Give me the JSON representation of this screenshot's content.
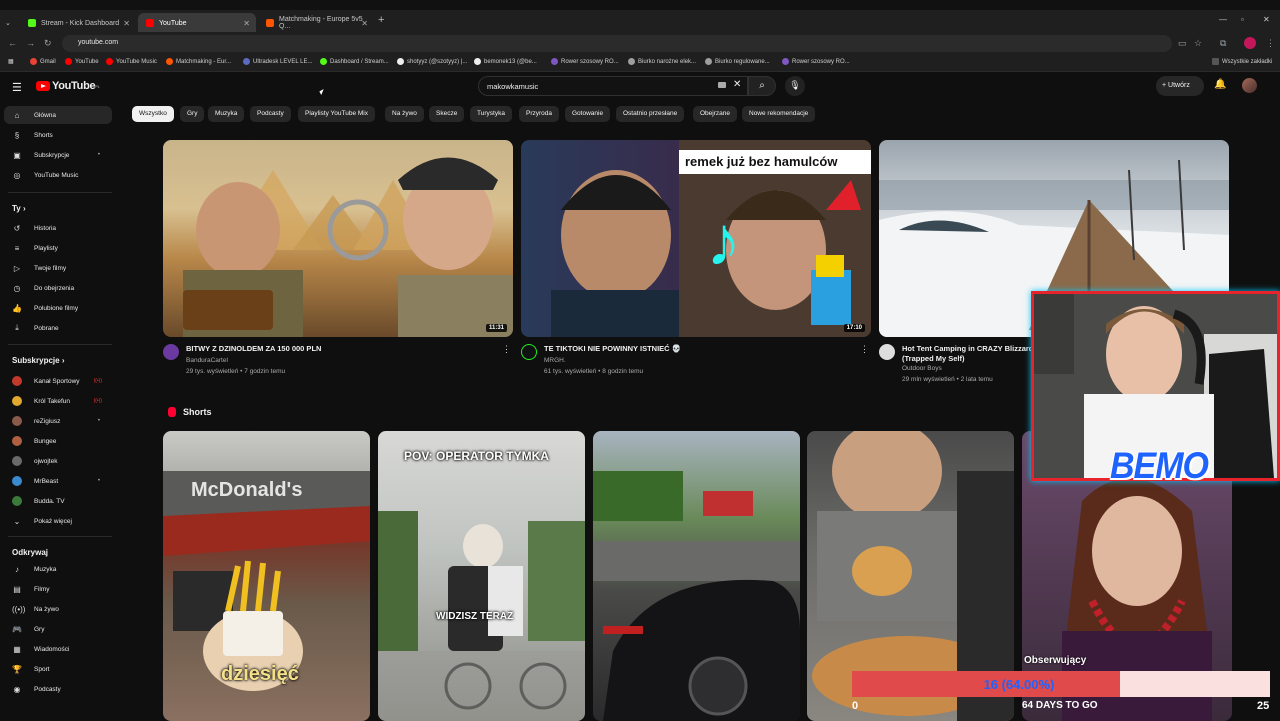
{
  "browser": {
    "tabs": [
      {
        "title": "Stream - Kick Dashboard",
        "color": "#53fc18"
      },
      {
        "title": "YouTube",
        "color": "#ff0000"
      },
      {
        "title": "Matchmaking - Europe 5v5 Q...",
        "color": "#ff5500"
      }
    ],
    "url": "youtube.com",
    "bookmarks": [
      "Gmail",
      "YouTube",
      "YouTube Music",
      "Matchmaking - Eur...",
      "Ultradesk LEVEL LE...",
      "Dashboard / Stream...",
      "shotyyz (@szotyyz) |...",
      "bemonek13 (@be...",
      "Rower szosowy RO...",
      "Biurko narożne elek...",
      "Biurko regulowane...",
      "Rower szosowy RO..."
    ],
    "bookmarks_right": "Wszystkie zakładki"
  },
  "masthead": {
    "logo": "YouTube",
    "logo_sup": "PL",
    "search_value": "makowkamusic",
    "create_label": "Utwórz"
  },
  "sidebar": {
    "main": [
      {
        "label": "Główna",
        "icon": "home-icon"
      },
      {
        "label": "Shorts",
        "icon": "shorts-icon"
      },
      {
        "label": "Subskrypcje",
        "icon": "subscriptions-icon"
      },
      {
        "label": "YouTube Music",
        "icon": "music-icon"
      }
    ],
    "you_heading": "Ty",
    "you": [
      {
        "label": "Historia",
        "icon": "history-icon"
      },
      {
        "label": "Playlisty",
        "icon": "playlist-icon"
      },
      {
        "label": "Twoje filmy",
        "icon": "your-videos-icon"
      },
      {
        "label": "Do obejrzenia",
        "icon": "watch-later-icon"
      },
      {
        "label": "Polubione filmy",
        "icon": "like-icon"
      },
      {
        "label": "Pobrane",
        "icon": "download-icon"
      }
    ],
    "subs_heading": "Subskrypcje",
    "subs": [
      {
        "label": "Kanał Sportowy",
        "color": "#c0392b",
        "live": true
      },
      {
        "label": "Król Takefun",
        "color": "#e0a82e",
        "live": true
      },
      {
        "label": "reZigiusz",
        "color": "#8a5a4a",
        "dot": true
      },
      {
        "label": "Bungee",
        "color": "#b06040"
      },
      {
        "label": "ojwojtek",
        "color": "#6a6a6a"
      },
      {
        "label": "MrBeast",
        "color": "#3a8ad0",
        "dot": true
      },
      {
        "label": "Budda. TV",
        "color": "#3b7a3b"
      }
    ],
    "show_more": "Pokaż więcej",
    "explore_heading": "Odkrywaj",
    "explore": [
      {
        "label": "Muzyka",
        "icon": "music-note-icon"
      },
      {
        "label": "Filmy",
        "icon": "film-icon"
      },
      {
        "label": "Na żywo",
        "icon": "live-icon"
      },
      {
        "label": "Gry",
        "icon": "gaming-icon"
      },
      {
        "label": "Wiadomości",
        "icon": "news-icon"
      },
      {
        "label": "Sport",
        "icon": "trophy-icon"
      },
      {
        "label": "Podcasty",
        "icon": "podcast-icon"
      }
    ]
  },
  "chips": [
    "Wszystko",
    "Gry",
    "Muzyka",
    "Podcasty",
    "Playlisty YouTube Mix",
    "Na żywo",
    "Skecze",
    "Turystyka",
    "Przyroda",
    "Gotowanie",
    "Ostatnio przesłane",
    "Obejrzane",
    "Nowe rekomendacje"
  ],
  "videos": [
    {
      "title": "BITWY Z DZINOLDEM ZA 150 000 PLN",
      "channel": "BanduraCartel",
      "meta": "29 tys. wyświetleń • 7 godzin temu",
      "duration": "11:31"
    },
    {
      "title": "TE TIKTOKI NIE POWINNY ISTNIEĆ 💀",
      "channel": "MRGH.",
      "meta": "61 tys. wyświetleń • 8 godzin temu",
      "duration": "17:10",
      "overlay": "remek już bez hamulców"
    },
    {
      "title": "Hot Tent Camping in CRAZY Blizzard (Trapped My Self)",
      "channel": "Outdoor Boys",
      "meta": "29 mln wyświetleń • 2 lata temu"
    }
  ],
  "shorts_heading": "Shorts",
  "shorts": [
    {
      "caption": "dziesięć",
      "sign": "McDonald's"
    },
    {
      "caption": "POV: OPERATOR TYMKA",
      "caption2": "WIDZISZ TERAZ"
    },
    {
      "caption": ""
    },
    {
      "caption": ""
    }
  ],
  "overlay": {
    "streamer_name": "BEMO",
    "goal_label": "Obserwujący",
    "goal_text": "16 (64.00%)",
    "goal_percent": 64,
    "goal_min": "0",
    "goal_days": "64 DAYS TO GO",
    "goal_max": "25"
  }
}
